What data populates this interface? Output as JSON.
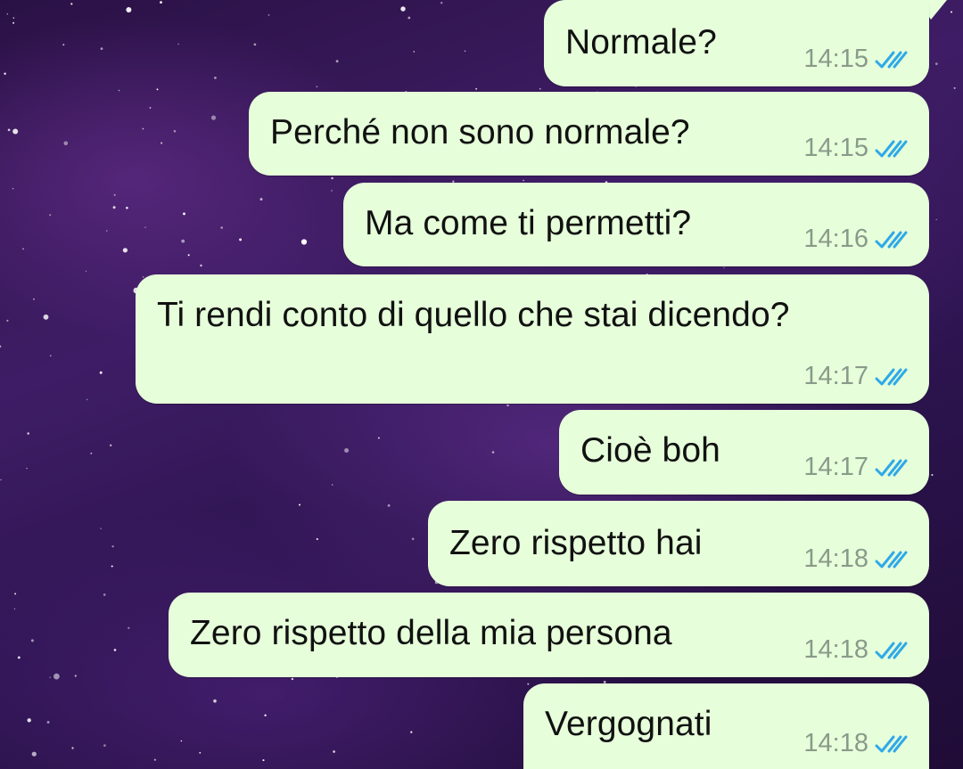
{
  "colors": {
    "bubble_background": "#e6ffda",
    "read_ticks": "#2fa9e8",
    "timestamp": "#8a9a8a",
    "wallpaper": "#3f1d66"
  },
  "messages": [
    {
      "text": "Normale?",
      "time": "14:15",
      "status_icon": "double-check-read-icon"
    },
    {
      "text": "Perché non sono normale?",
      "time": "14:15",
      "status_icon": "double-check-read-icon"
    },
    {
      "text": "Ma come ti permetti?",
      "time": "14:16",
      "status_icon": "double-check-read-icon"
    },
    {
      "text": "Ti rendi conto di quello che stai dicendo?",
      "time": "14:17",
      "status_icon": "double-check-read-icon"
    },
    {
      "text": "Cioè boh",
      "time": "14:17",
      "status_icon": "double-check-read-icon"
    },
    {
      "text": "Zero rispetto hai",
      "time": "14:18",
      "status_icon": "double-check-read-icon"
    },
    {
      "text": "Zero rispetto della mia persona",
      "time": "14:18",
      "status_icon": "double-check-read-icon"
    },
    {
      "text": "Vergognati",
      "time": "14:18",
      "status_icon": "double-check-read-icon"
    }
  ]
}
